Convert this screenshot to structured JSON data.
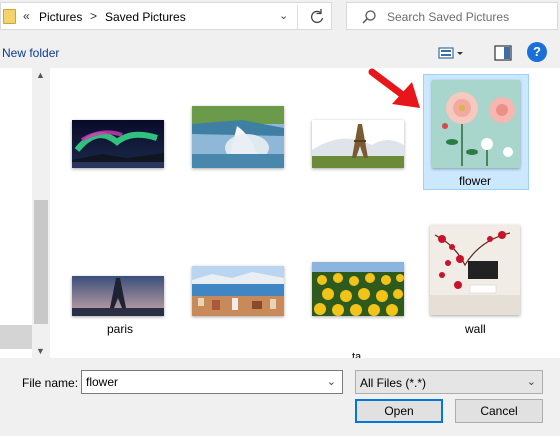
{
  "address": {
    "chevrons": "«",
    "crumbs": [
      "Pictures",
      "Saved Pictures"
    ],
    "separator": ">"
  },
  "search": {
    "placeholder": "Search Saved Pictures"
  },
  "toolbar": {
    "new_folder_label": "New folder",
    "help_label": "?"
  },
  "files": [
    {
      "name": "",
      "kind": "aurora"
    },
    {
      "name": "",
      "kind": "waterfall"
    },
    {
      "name": "",
      "kind": "eiffel-sky"
    },
    {
      "name": "flower",
      "kind": "flower",
      "selected": true
    },
    {
      "name": "paris",
      "kind": "paris"
    },
    {
      "name": "",
      "kind": "city"
    },
    {
      "name": "",
      "kind": "sunflowers"
    },
    {
      "name": "wall",
      "kind": "wall"
    }
  ],
  "partial_label": "ta",
  "footer": {
    "file_name_label": "File name:",
    "file_name_value": "flower",
    "file_type_value": "All Files (*.*)",
    "open_label": "Open",
    "cancel_label": "Cancel"
  },
  "colors": {
    "selection": "#cce8ff",
    "accent": "#0078d7",
    "arrow": "#e8151b"
  }
}
